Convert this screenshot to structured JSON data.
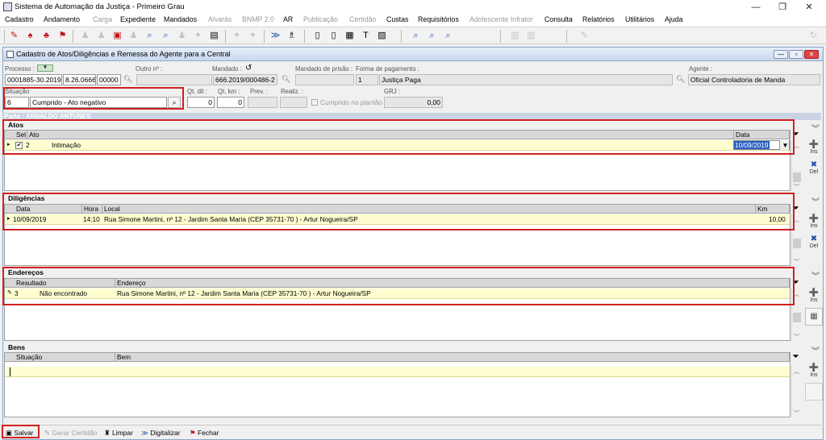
{
  "app": {
    "title": "Sistema de Automação da Justiça - Primeiro Grau",
    "window_controls": {
      "minimize": "—",
      "maximize": "❐",
      "close": "✕"
    }
  },
  "menu": [
    "Cadastro",
    "Andamento",
    "Carga",
    "Expediente",
    "Mandados",
    "Alvarás",
    "BNMP 2.0",
    "AR",
    "Publicação",
    "Certidão",
    "Custas",
    "Requisitórios",
    "Adolescente Infrator",
    "Consulta",
    "Relatórios",
    "Utilitários",
    "Ajuda"
  ],
  "menu_disabled": [
    "Carga",
    "Alvarás",
    "BNMP 2.0",
    "Publicação",
    "Certidão",
    "Adolescente Infrator"
  ],
  "form": {
    "title": "Cadastro de Atos/Diligências e Remessa do Agente para a Central"
  },
  "fields": {
    "processo_label": "Processo :",
    "processo": "0001885-30.2019",
    "processo_sufixo": "8.26.0666",
    "processo_seq": "00000",
    "outro_label": "Outro nº :",
    "outro": "",
    "mandado_label": "Mandado :",
    "mandado": "666.2019/000486-2",
    "prisao_label": "Mandado de prisão :",
    "prisao": "",
    "pagamento_label": "Forma de pagamento :",
    "pagamento_codigo": "1",
    "pagamento": "Justiça Paga",
    "agente_label": "Agente :",
    "agente": "Oficial Controladoria de Manda",
    "situacao_label": "Situação",
    "situacao_codigo": "6",
    "situacao": "Cumprido - Ato negativo",
    "qtdil_label": "Qt. dil :",
    "qtdil": "0",
    "qtkm_label": "Qt. km :",
    "qtkm": "0",
    "prev_label": "Prev. :",
    "realiz_label": "Realiz. :",
    "cumprido_plantao": "Cumprido no plantão",
    "grj_label": "GRJ :",
    "grj": "0,00"
  },
  "parte": "Parte : ARNALDO ANTUNES",
  "atos": {
    "title": "Atos",
    "headers": {
      "sel": "Sel",
      "ato": "Ato",
      "data": "Data"
    },
    "rows": [
      {
        "codigo": "2",
        "ato": "Intimação",
        "data": "10/09/2019"
      }
    ]
  },
  "diligencias": {
    "title": "Diligências",
    "headers": {
      "data": "Data",
      "hora": "Hora",
      "local": "Local",
      "km": "Km"
    },
    "rows": [
      {
        "data": "10/09/2019",
        "hora": "14:10",
        "local": "Rua Simone Martini, nº 12 - Jardim Santa Maria (CEP 35731-70 ) - Artur Nogueira/SP",
        "km": "10,00"
      }
    ]
  },
  "enderecos": {
    "title": "Endereços",
    "headers": {
      "resultado": "Resultado",
      "endereco": "Endereço"
    },
    "rows": [
      {
        "codigo": "3",
        "resultado": "Não encontrado",
        "endereco": "Rua Simone Martini, nº 12 - Jardim Santa Maria (CEP 35731-70 ) - Artur Nogueira/SP"
      }
    ]
  },
  "bens": {
    "title": "Bens",
    "headers": {
      "situacao": "Situação",
      "bem": "Bem"
    }
  },
  "side": {
    "ins": "Ins",
    "del": "Del"
  },
  "footer": {
    "salvar": "Salvar",
    "gerar": "Gerar Certidão",
    "limpar": "Limpar",
    "digitalizar": "Digitalizar",
    "fechar": "Fechar"
  },
  "colors": {
    "highlight": "#d02020",
    "row_bg": "#fefdcf",
    "title_bg": "#c8d8ee"
  }
}
